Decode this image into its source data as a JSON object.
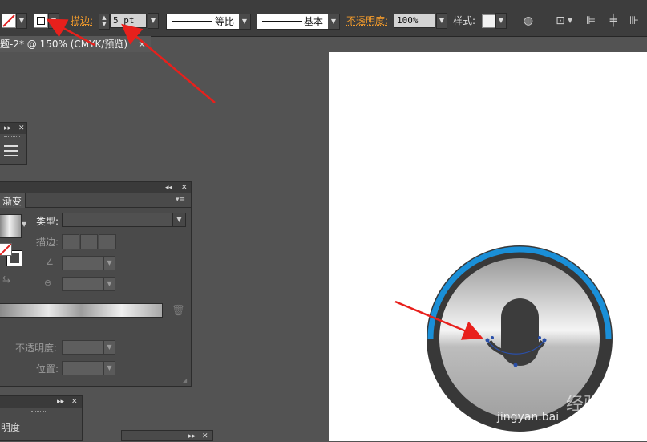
{
  "control_bar": {
    "stroke_label": "描边:",
    "stroke_width": "5 pt",
    "profile_label": "等比",
    "brush_label": "基本",
    "opacity_label": "不透明度:",
    "opacity_value": "100%",
    "style_label": "样式:"
  },
  "document_tab": {
    "title": "题-2* @ 150% (CMYK/预览)",
    "close": "×"
  },
  "gradient_panel": {
    "tab_label": "渐变",
    "type_label": "类型:",
    "stroke_label": "描边:",
    "opacity_label": "不透明度:",
    "location_label": "位置:"
  },
  "bottom_panel": {
    "label": "明度"
  },
  "watermark": {
    "text": "jingyan.bai",
    "brand": "经验"
  },
  "colors": {
    "accent_orange": "#f29b2c",
    "annotation_red": "#e8201c",
    "ring_blue": "#1a8fd8",
    "dark_ring": "#3a3a3a",
    "path_blue": "#2a4fa8"
  }
}
